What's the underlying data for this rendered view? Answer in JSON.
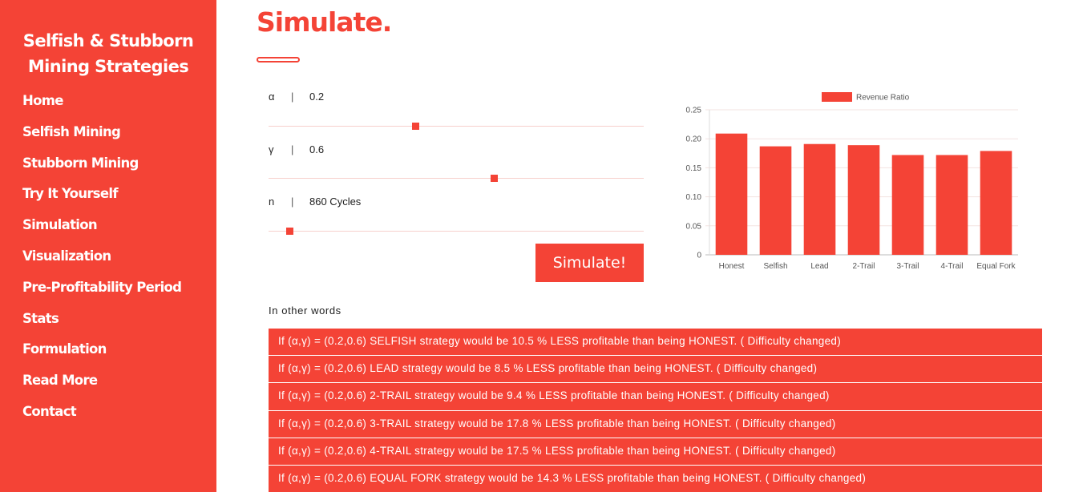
{
  "sidebar": {
    "brand_line1": "Selfish & Stubborn",
    "brand_line2": "Mining Strategies",
    "items": [
      {
        "label": "Home"
      },
      {
        "label": "Selfish Mining"
      },
      {
        "label": "Stubborn Mining"
      },
      {
        "label": "Try It Yourself"
      },
      {
        "label": "Simulation"
      },
      {
        "label": "Visualization"
      },
      {
        "label": "Pre-Profitability Period"
      },
      {
        "label": "Stats"
      },
      {
        "label": "Formulation"
      },
      {
        "label": "Read More"
      },
      {
        "label": "Contact"
      }
    ]
  },
  "main": {
    "title": "Simulate.",
    "params": [
      {
        "symbol": "α",
        "sep": "|",
        "value": "0.2",
        "slider_fraction": 0.39
      },
      {
        "symbol": "γ",
        "sep": "|",
        "value": "0.6",
        "slider_fraction": 0.6
      },
      {
        "symbol": "n",
        "sep": "|",
        "value": "860 Cycles",
        "slider_fraction": 0.055
      }
    ],
    "simulate_label": "Simulate!",
    "words_label": "In other words",
    "results": [
      "If (α,γ) = (0.2,0.6) SELFISH strategy would be 10.5 % LESS profitable than being HONEST. ( Difficulty changed)",
      "If (α,γ) = (0.2,0.6) LEAD strategy would be 8.5 % LESS profitable than being HONEST. ( Difficulty changed)",
      "If (α,γ) = (0.2,0.6) 2-TRAIL strategy would be 9.4 % LESS profitable than being HONEST. ( Difficulty changed)",
      "If (α,γ) = (0.2,0.6) 3-TRAIL strategy would be 17.8 % LESS profitable than being HONEST. ( Difficulty changed)",
      "If (α,γ) = (0.2,0.6) 4-TRAIL strategy would be 17.5 % LESS profitable than being HONEST. ( Difficulty changed)",
      "If (α,γ) = (0.2,0.6) EQUAL FORK strategy would be 14.3 % LESS profitable than being HONEST. ( Difficulty changed)"
    ]
  },
  "colors": {
    "accent": "#f44336",
    "bar_fill": "#f44336"
  },
  "chart_data": {
    "type": "bar",
    "categories": [
      "Honest",
      "Selfish",
      "Lead",
      "2-Trail",
      "3-Trail",
      "4-Trail",
      "Equal Fork"
    ],
    "series": [
      {
        "name": "Revenue Ratio",
        "values": [
          0.209,
          0.187,
          0.191,
          0.189,
          0.172,
          0.172,
          0.179
        ]
      }
    ],
    "ylim": [
      0,
      0.25
    ],
    "yticks": [
      "0",
      "0.05",
      "0.10",
      "0.15",
      "0.20",
      "0.25"
    ],
    "ytick_values": [
      0,
      0.05,
      0.1,
      0.15,
      0.2,
      0.25
    ],
    "legend": "top",
    "grid": true
  }
}
